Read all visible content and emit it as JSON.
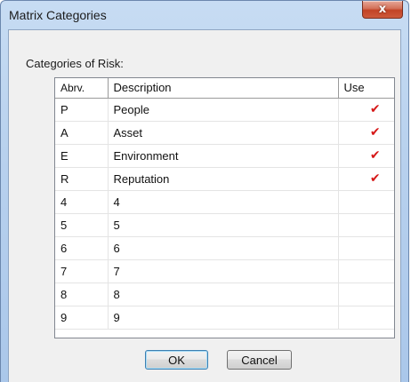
{
  "window": {
    "title": "Matrix Categories",
    "close_label": "x"
  },
  "group_label": "Categories of Risk:",
  "table": {
    "headers": {
      "abrv": "Abrv.",
      "description": "Description",
      "use": "Use"
    },
    "rows": [
      {
        "abrv": "P",
        "description": "People",
        "use": true
      },
      {
        "abrv": "A",
        "description": "Asset",
        "use": true
      },
      {
        "abrv": "E",
        "description": "Environment",
        "use": true
      },
      {
        "abrv": "R",
        "description": "Reputation",
        "use": true
      },
      {
        "abrv": "4",
        "description": "4",
        "use": false
      },
      {
        "abrv": "5",
        "description": "5",
        "use": false
      },
      {
        "abrv": "6",
        "description": "6",
        "use": false
      },
      {
        "abrv": "7",
        "description": "7",
        "use": false
      },
      {
        "abrv": "8",
        "description": "8",
        "use": false
      },
      {
        "abrv": "9",
        "description": "9",
        "use": false
      }
    ],
    "check_glyph": "✔",
    "check_color": "#d61818"
  },
  "buttons": {
    "ok": "OK",
    "cancel": "Cancel"
  }
}
